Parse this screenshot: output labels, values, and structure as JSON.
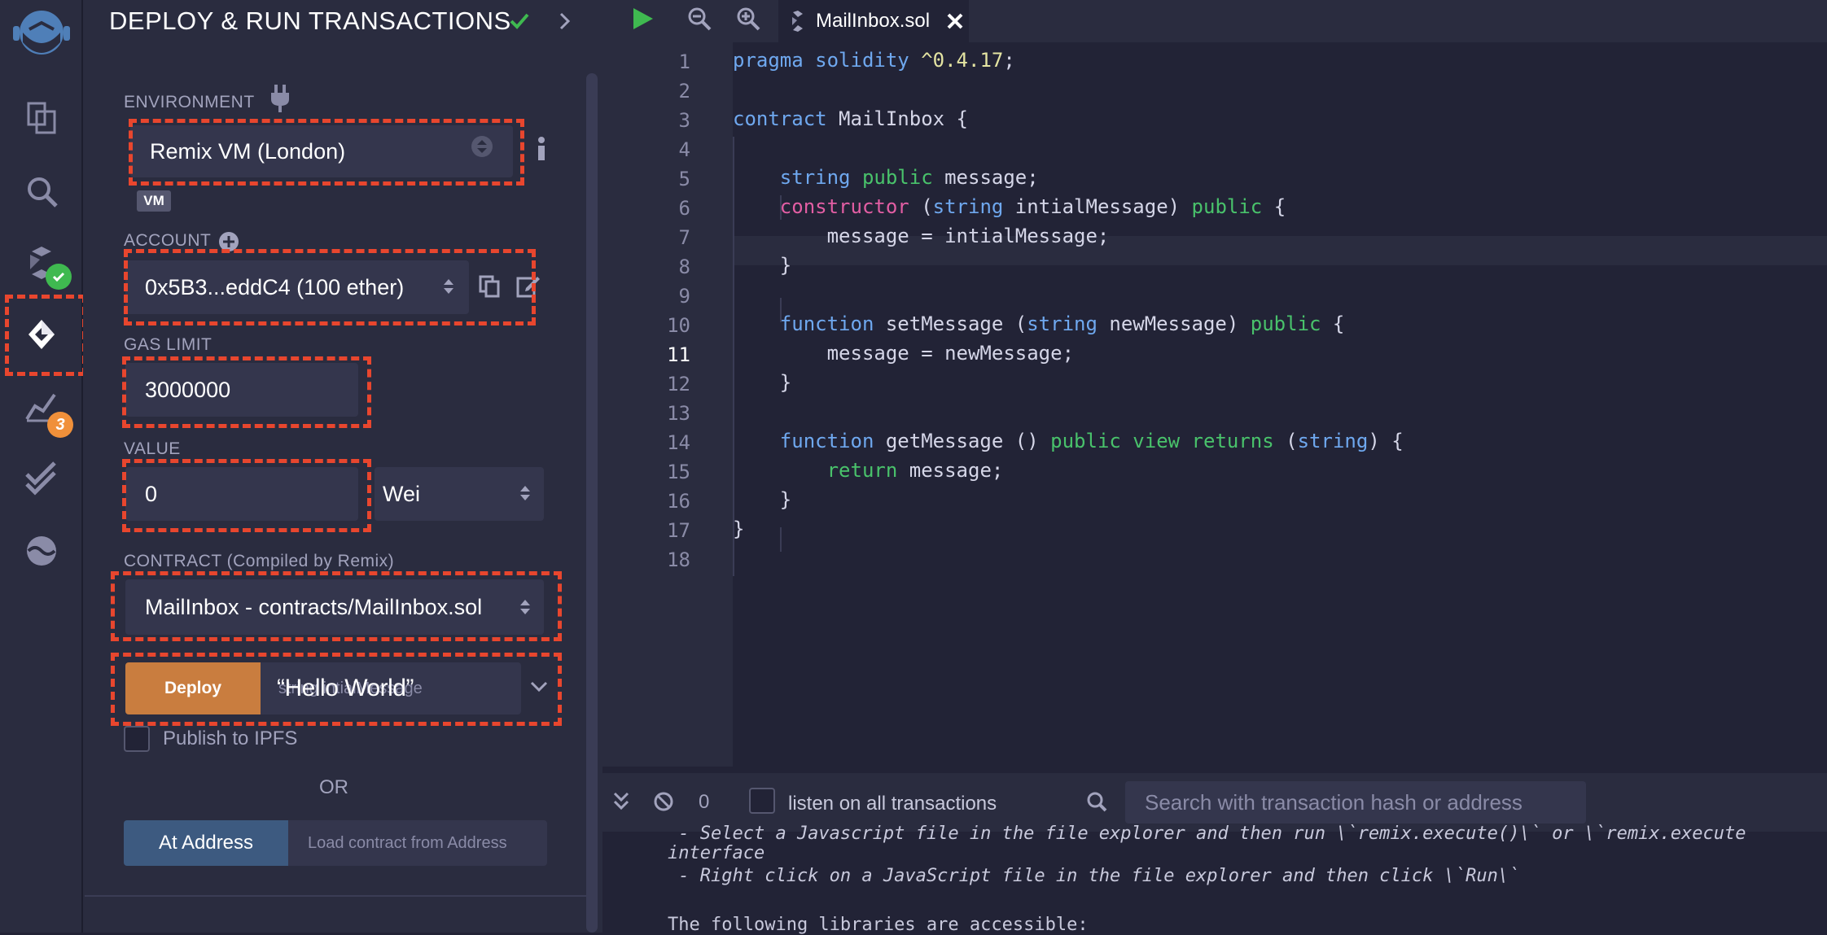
{
  "panel": {
    "title": "DEPLOY & RUN TRANSACTIONS",
    "environment_label": "ENVIRONMENT",
    "environment_value": "Remix VM (London)",
    "vm_badge": "VM",
    "account_label": "ACCOUNT",
    "account_value": "0x5B3...eddC4 (100 ether)",
    "gas_label": "GAS LIMIT",
    "gas_value": "3000000",
    "value_label": "VALUE",
    "value_amount": "0",
    "value_unit": "Wei",
    "contract_label": "CONTRACT (Compiled by Remix)",
    "contract_value": "MailInbox - contracts/MailInbox.sol",
    "deploy_label": "Deploy",
    "deploy_arg_placeholder": "string intialMessage",
    "deploy_arg_value": "“Hello World”",
    "publish_label": "Publish to IPFS",
    "or_label": "OR",
    "at_address_label": "At Address",
    "load_placeholder": "Load contract from Address"
  },
  "rail": {
    "badge_count": "3",
    "icons": [
      "remix-logo-icon",
      "file-explorer-icon",
      "search-icon",
      "compiler-icon",
      "deploy-icon",
      "analysis-icon",
      "tests-icon",
      "plugin-icon"
    ]
  },
  "editor": {
    "tab": "MailInbox.sol",
    "current_line": "11",
    "line_numbers": [
      "1",
      "2",
      "3",
      "4",
      "5",
      "6",
      "7",
      "8",
      "9",
      "10",
      "11",
      "12",
      "13",
      "14",
      "15",
      "16",
      "17",
      "18"
    ]
  },
  "terminal": {
    "count": "0",
    "listen_label": "listen on all transactions",
    "search_placeholder": "Search with transaction hash or address",
    "lines": [
      " - Select a Javascript file in the file explorer and then run \\`remix.execute()\\` or \\`remix.execute",
      "interface",
      " - Right click on a JavaScript file in the file explorer and then click \\`Run\\`",
      "",
      "The following libraries are accessible:"
    ]
  },
  "colors": {
    "accent_orange": "#c97d3f",
    "dash_red": "#e8462e",
    "check_green": "#3fb950",
    "badge_orange": "#f0903a",
    "at_address_blue": "#3d5a80"
  }
}
